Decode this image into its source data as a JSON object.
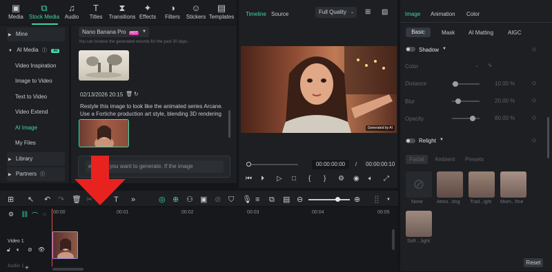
{
  "toolbar": {
    "items": [
      {
        "label": "Media",
        "icon": "media-icon"
      },
      {
        "label": "Stock Media",
        "icon": "stock-media-icon"
      },
      {
        "label": "Audio",
        "icon": "audio-icon"
      },
      {
        "label": "Titles",
        "icon": "titles-icon"
      },
      {
        "label": "Transitions",
        "icon": "transitions-icon"
      },
      {
        "label": "Effects",
        "icon": "effects-icon"
      },
      {
        "label": "Filters",
        "icon": "filters-icon"
      },
      {
        "label": "Stickers",
        "icon": "stickers-icon"
      },
      {
        "label": "Templates",
        "icon": "templates-icon"
      }
    ],
    "active": "Stock Media"
  },
  "sidebar": {
    "items": [
      {
        "label": "Mine"
      },
      {
        "label": "AI Media",
        "badge": "AI"
      },
      {
        "label": "Video Inspiration"
      },
      {
        "label": "Image to Video"
      },
      {
        "label": "Text to Video"
      },
      {
        "label": "Video Extend"
      },
      {
        "label": "AI Image"
      },
      {
        "label": "My Files"
      },
      {
        "label": "Library"
      },
      {
        "label": "Partners"
      }
    ]
  },
  "media_panel": {
    "model_select": "Nano Banana Pro",
    "model_badge": "HOT",
    "notice": "You can browse the generated records for the past 30 days.",
    "record_date": "02/13/2026 20:15",
    "prompt_text": "Restyle this image to look like the animated series Arcane. Use a Fortiche production art style, blending 3D rendering with ...",
    "input_placeholder": "e image you want to generate. If the image"
  },
  "preview": {
    "tabs": [
      "Timeline",
      "Source"
    ],
    "active_tab": "Timeline",
    "quality": "Full Quality",
    "watermark": "Generated by AI",
    "current_time": "00:00:00:00",
    "separator": "/",
    "total_time": "00:00:00:10"
  },
  "inspector": {
    "top_tabs": [
      "Image",
      "Animation",
      "Color"
    ],
    "active_top": "Image",
    "sub_tabs": [
      "Basic",
      "Mask",
      "AI Matting",
      "AIGC"
    ],
    "active_sub": "Basic",
    "shadow_label": "Shadow",
    "color_label": "Color",
    "distance_label": "Distance",
    "distance_value": "10.00 %",
    "blur_label": "Blur",
    "blur_value": "20.00 %",
    "opacity_label": "Opacity",
    "opacity_value": "80.00 %",
    "relight_label": "Relight",
    "relight_tabs": [
      "Facial",
      "Ambient",
      "Presets"
    ],
    "presets": [
      "None",
      "Atmo...ting",
      "Trad...ight",
      "Morn...ftne",
      "Soft ...light"
    ],
    "reset_label": "Reset"
  },
  "timeline": {
    "ruler": [
      "00:00",
      "00:01",
      "00:02",
      "00:03",
      "00:04",
      "00:05"
    ],
    "track_label": "Video 1",
    "audio_label": "Audio 1"
  }
}
